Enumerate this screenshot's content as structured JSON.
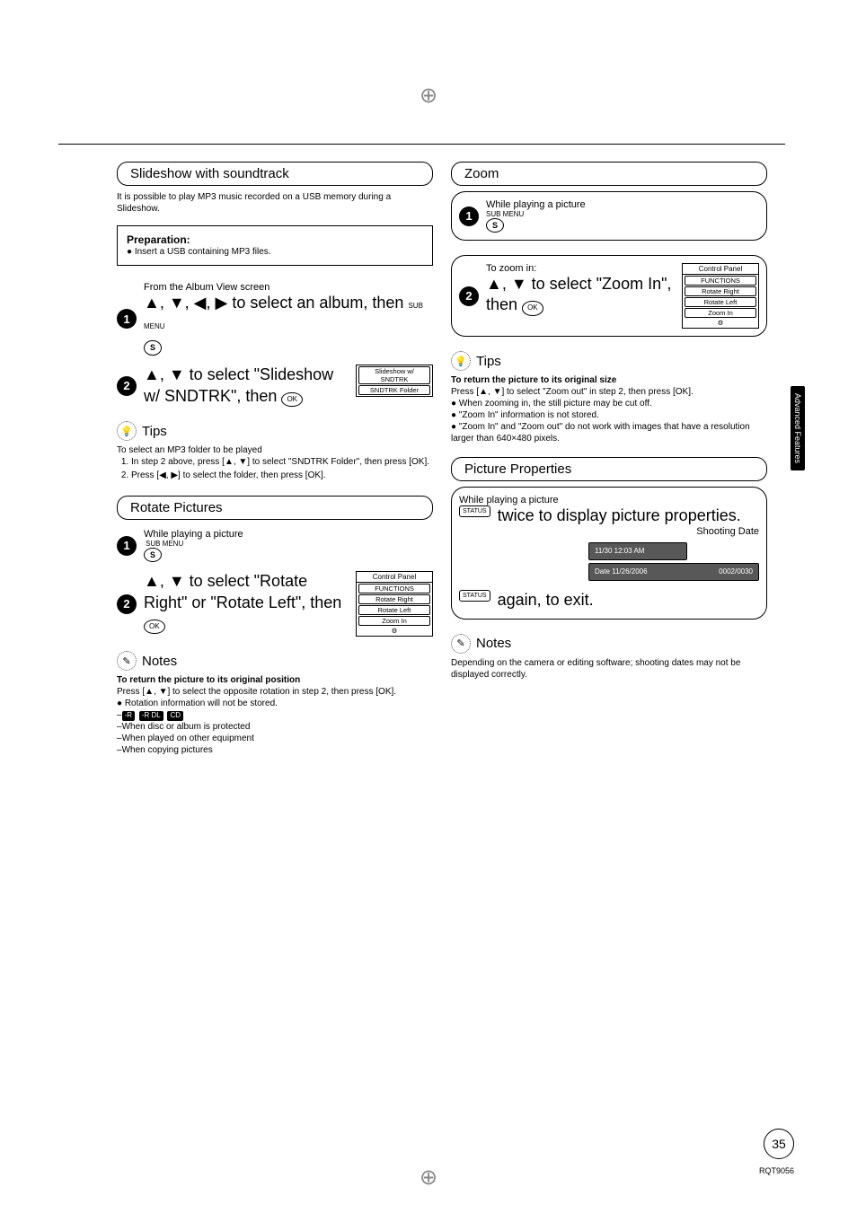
{
  "sections": {
    "slideshow": {
      "title": "Slideshow with soundtrack",
      "intro": "It is possible to play MP3 music recorded on a USB memory during a Slideshow.",
      "prep_label": "Preparation:",
      "prep_bullet": "Insert a USB containing MP3 files.",
      "step1_sub": "From the Album View screen",
      "step1_main_pre": "▲, ▼, ◀, ▶ to select an album, then",
      "step1_submenu": "SUB MENU",
      "step2_main": "▲, ▼ to select \"Slideshow w/ SNDTRK\", then",
      "step2_menu": [
        "Slideshow w/ SNDTRK",
        "SNDTRK Folder"
      ]
    },
    "tips1": {
      "title": "Tips",
      "line1": "To select an MP3 folder to be played",
      "li1": "In step 2 above, press [▲, ▼] to select \"SNDTRK Folder\", then press [OK].",
      "li2": "Press [◀, ▶] to select the folder, then press [OK]."
    },
    "rotate": {
      "title": "Rotate Pictures",
      "step1_sub": "While playing a picture",
      "step1_submenu": "SUB MENU",
      "step2_main": "▲, ▼ to select \"Rotate Right\" or \"Rotate Left\", then",
      "menu_header": "Control Panel",
      "menu": [
        "FUNCTIONS",
        "Rotate Right",
        "Rotate Left",
        "Zoom In"
      ]
    },
    "notes1": {
      "title": "Notes",
      "bold": "To return the picture to its original position",
      "body": "Press [▲, ▼] to select the opposite rotation in step 2, then press [OK].",
      "bullet": "Rotation information will not be stored.",
      "discs": [
        "-R",
        "-R DL",
        "CD"
      ],
      "sub1": "When disc or album is protected",
      "sub2": "When played on other equipment",
      "sub3": "When copying pictures"
    },
    "zoom": {
      "title": "Zoom",
      "step1_sub": "While playing a picture",
      "step1_submenu": "SUB MENU",
      "step2_pre": "To zoom in:",
      "step2_main": "▲, ▼ to select \"Zoom In\", then",
      "menu_header": "Control Panel",
      "menu": [
        "FUNCTIONS",
        "Rotate Right",
        "Rotate Left",
        "Zoom In"
      ]
    },
    "tips2": {
      "title": "Tips",
      "bold": "To return the picture to its original size",
      "l1": "Press [▲, ▼] to select \"Zoom out\" in step 2, then press [OK].",
      "l2": "When zooming in, the still picture may be cut off.",
      "l3": "\"Zoom In\" information is not stored.",
      "l4": "\"Zoom In\" and \"Zoom out\" do not work with images that have a resolution larger than 640×480 pixels."
    },
    "picprop": {
      "title": "Picture Properties",
      "sub": "While playing a picture",
      "status": "STATUS",
      "main1": "twice to display picture properties.",
      "shoot_label": "Shooting Date",
      "osd_top": "11/30  12:03 AM",
      "osd_bot_left": "Date  11/26/2006",
      "osd_bot_right": "0002/0030",
      "main2": "again, to exit."
    },
    "notes2": {
      "title": "Notes",
      "body": "Depending on the camera or editing software; shooting dates may not be displayed correctly."
    }
  },
  "labels": {
    "s_button": "S",
    "ok_button": "OK",
    "side_tab": "Advanced Features",
    "page_num": "35",
    "doc_code": "RQT9056"
  }
}
